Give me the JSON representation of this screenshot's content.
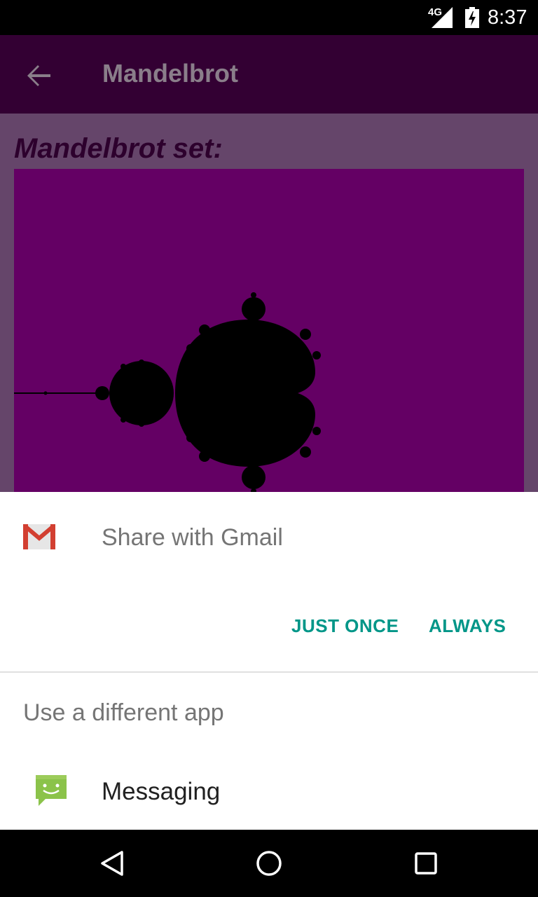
{
  "status_bar": {
    "network": "4G",
    "time": "8:37"
  },
  "app_bar": {
    "title": "Mandelbrot",
    "back_icon": "arrow-left-icon"
  },
  "content": {
    "heading": "Mandelbrot set:"
  },
  "share_sheet": {
    "title": "Share with Gmail",
    "just_once_label": "JUST ONCE",
    "always_label": "ALWAYS",
    "different_app_label": "Use a different app",
    "apps": [
      {
        "label": "Messaging",
        "icon": "messaging-icon"
      }
    ],
    "accent_color": "#009688"
  },
  "nav_bar": {
    "back_icon": "back-triangle-icon",
    "home_icon": "home-circle-icon",
    "recents_icon": "recents-square-icon"
  }
}
